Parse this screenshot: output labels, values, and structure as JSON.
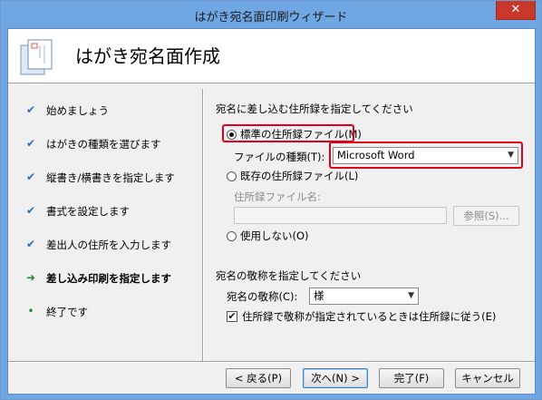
{
  "window": {
    "title": "はがき宛名面印刷ウィザード",
    "close_glyph": "✕"
  },
  "header": {
    "title": "はがき宛名面作成"
  },
  "steps": [
    {
      "label": "始めましょう",
      "mark": "✔"
    },
    {
      "label": "はがきの種類を選びます",
      "mark": "✔"
    },
    {
      "label": "縦書き/横書きを指定します",
      "mark": "✔"
    },
    {
      "label": "書式を設定します",
      "mark": "✔"
    },
    {
      "label": "差出人の住所を入力します",
      "mark": "✔"
    },
    {
      "label": "差し込み印刷を指定します",
      "mark": "➜"
    },
    {
      "label": "終了です",
      "mark": "•"
    }
  ],
  "address_book": {
    "heading": "宛名に差し込む住所録を指定してください",
    "standard_label": "標準の住所録ファイル(M)",
    "file_type_label": "ファイルの種類(T):",
    "file_type_value": "Microsoft Word",
    "existing_label": "既存の住所録ファイル(L)",
    "file_name_label": "住所録ファイル名:",
    "browse_label": "参照(S)...",
    "none_label": "使用しない(O)"
  },
  "honorific": {
    "heading": "宛名の敬称を指定してください",
    "label": "宛名の敬称(C):",
    "value": "様",
    "checkbox_label": "住所録で敬称が指定されているときは住所録に従う(E)",
    "checkbox_mark": "✔"
  },
  "buttons": {
    "back": "< 戻る(P)",
    "next": "次へ(N) >",
    "finish": "完了(F)",
    "cancel": "キャンセル"
  },
  "colors": {
    "highlight": "#e0001b",
    "title_bar": "#6fa7e4",
    "close": "#c8392b"
  }
}
